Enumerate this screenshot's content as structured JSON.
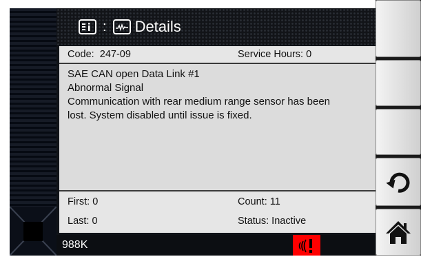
{
  "header": {
    "title": "Details",
    "separator": ":",
    "info_icon": "info-list-icon",
    "waveform_icon": "waveform-icon"
  },
  "fault": {
    "code_label": "Code:",
    "code": "247-09",
    "service_hours_label": "Service Hours:",
    "service_hours": "0",
    "description_lines": [
      "SAE CAN open Data Link #1",
      "Abnormal Signal",
      "Communication with rear medium range sensor has been",
      "lost. System disabled until issue is fixed."
    ],
    "first_label": "First:",
    "first": "0",
    "count_label": "Count:",
    "count": "11",
    "last_label": "Last:",
    "last": "0",
    "status_label": "Status:",
    "status": "Inactive"
  },
  "status_bar": {
    "model": "988K",
    "alert_icon": "sensor-alert-icon",
    "alert_color": "#ff0000"
  },
  "right_buttons": [
    {
      "name": "blank-button-1",
      "icon": ""
    },
    {
      "name": "blank-button-2",
      "icon": ""
    },
    {
      "name": "blank-button-3",
      "icon": ""
    },
    {
      "name": "back-button",
      "icon": "undo-arrow-icon"
    },
    {
      "name": "home-button",
      "icon": "home-icon"
    }
  ]
}
